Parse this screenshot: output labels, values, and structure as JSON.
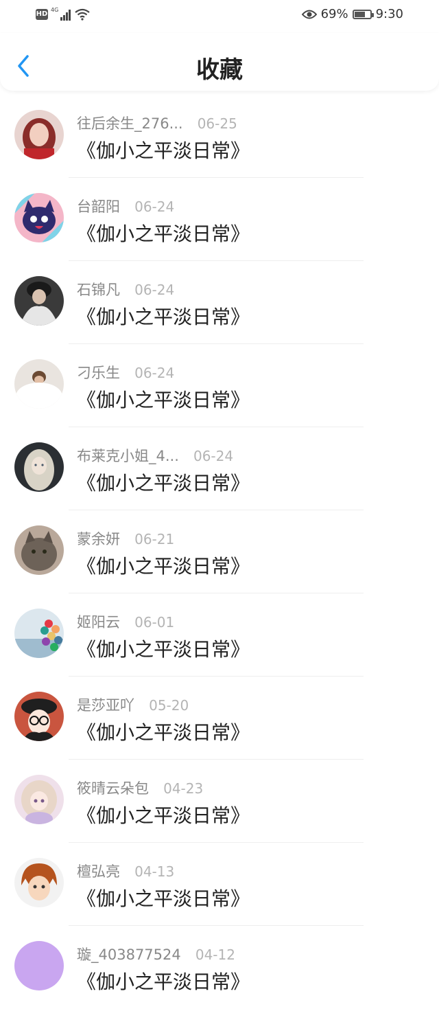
{
  "status_bar": {
    "hd": "HD",
    "network": "4G",
    "battery_percent": "69%",
    "battery_level": 0.69,
    "time": "9:30",
    "icons": [
      "signal-icon",
      "wifi-icon",
      "eye-icon",
      "battery-icon"
    ]
  },
  "header": {
    "title": "收藏",
    "back_icon": "chevron-left-icon",
    "accent": "#2196f3"
  },
  "favorites": [
    {
      "user": "往后余生_276...",
      "date": "06-25",
      "title": "《伽小之平淡日常》"
    },
    {
      "user": "台韶阳",
      "date": "06-24",
      "title": "《伽小之平淡日常》"
    },
    {
      "user": "石锦凡",
      "date": "06-24",
      "title": "《伽小之平淡日常》"
    },
    {
      "user": "刁乐生",
      "date": "06-24",
      "title": "《伽小之平淡日常》"
    },
    {
      "user": "布莱克小姐_4...",
      "date": "06-24",
      "title": "《伽小之平淡日常》"
    },
    {
      "user": "蒙余妍",
      "date": "06-21",
      "title": "《伽小之平淡日常》"
    },
    {
      "user": "姬阳云",
      "date": "06-01",
      "title": "《伽小之平淡日常》"
    },
    {
      "user": "是莎亚吖",
      "date": "05-20",
      "title": "《伽小之平淡日常》"
    },
    {
      "user": "筱晴云朵包",
      "date": "04-23",
      "title": "《伽小之平淡日常》"
    },
    {
      "user": "檀弘亮",
      "date": "04-13",
      "title": "《伽小之平淡日常》"
    },
    {
      "user": "璇_403877524",
      "date": "04-12",
      "title": "《伽小之平淡日常》"
    }
  ]
}
